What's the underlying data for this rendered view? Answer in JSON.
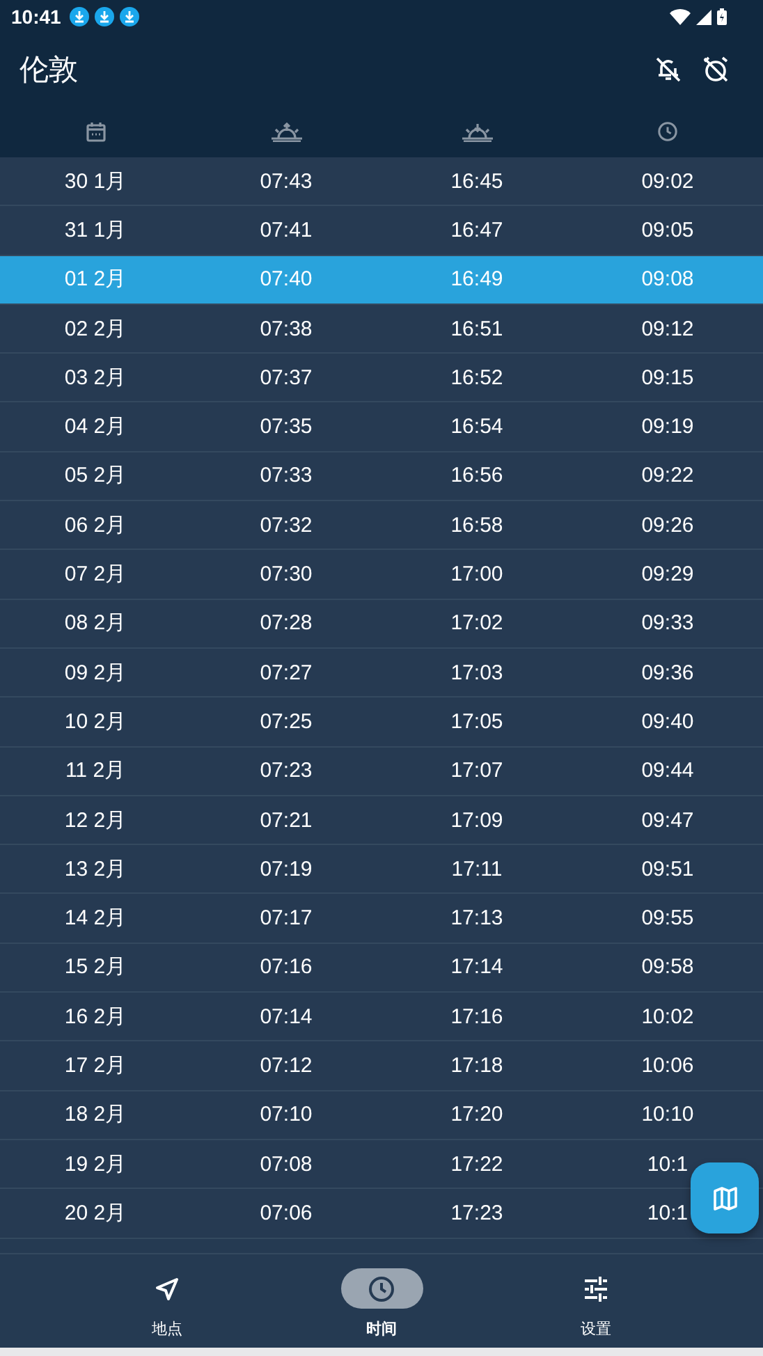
{
  "status_bar": {
    "time": "10:41"
  },
  "toolbar": {
    "title": "伦敦"
  },
  "rows": [
    {
      "date": "30 1月",
      "sunrise": "07:43",
      "sunset": "16:45",
      "day_length": "09:02",
      "selected": false
    },
    {
      "date": "31 1月",
      "sunrise": "07:41",
      "sunset": "16:47",
      "day_length": "09:05",
      "selected": false
    },
    {
      "date": "01 2月",
      "sunrise": "07:40",
      "sunset": "16:49",
      "day_length": "09:08",
      "selected": true
    },
    {
      "date": "02 2月",
      "sunrise": "07:38",
      "sunset": "16:51",
      "day_length": "09:12",
      "selected": false
    },
    {
      "date": "03 2月",
      "sunrise": "07:37",
      "sunset": "16:52",
      "day_length": "09:15",
      "selected": false
    },
    {
      "date": "04 2月",
      "sunrise": "07:35",
      "sunset": "16:54",
      "day_length": "09:19",
      "selected": false
    },
    {
      "date": "05 2月",
      "sunrise": "07:33",
      "sunset": "16:56",
      "day_length": "09:22",
      "selected": false
    },
    {
      "date": "06 2月",
      "sunrise": "07:32",
      "sunset": "16:58",
      "day_length": "09:26",
      "selected": false
    },
    {
      "date": "07 2月",
      "sunrise": "07:30",
      "sunset": "17:00",
      "day_length": "09:29",
      "selected": false
    },
    {
      "date": "08 2月",
      "sunrise": "07:28",
      "sunset": "17:02",
      "day_length": "09:33",
      "selected": false
    },
    {
      "date": "09 2月",
      "sunrise": "07:27",
      "sunset": "17:03",
      "day_length": "09:36",
      "selected": false
    },
    {
      "date": "10 2月",
      "sunrise": "07:25",
      "sunset": "17:05",
      "day_length": "09:40",
      "selected": false
    },
    {
      "date": "11 2月",
      "sunrise": "07:23",
      "sunset": "17:07",
      "day_length": "09:44",
      "selected": false
    },
    {
      "date": "12 2月",
      "sunrise": "07:21",
      "sunset": "17:09",
      "day_length": "09:47",
      "selected": false
    },
    {
      "date": "13 2月",
      "sunrise": "07:19",
      "sunset": "17:11",
      "day_length": "09:51",
      "selected": false
    },
    {
      "date": "14 2月",
      "sunrise": "07:17",
      "sunset": "17:13",
      "day_length": "09:55",
      "selected": false
    },
    {
      "date": "15 2月",
      "sunrise": "07:16",
      "sunset": "17:14",
      "day_length": "09:58",
      "selected": false
    },
    {
      "date": "16 2月",
      "sunrise": "07:14",
      "sunset": "17:16",
      "day_length": "10:02",
      "selected": false
    },
    {
      "date": "17 2月",
      "sunrise": "07:12",
      "sunset": "17:18",
      "day_length": "10:06",
      "selected": false
    },
    {
      "date": "18 2月",
      "sunrise": "07:10",
      "sunset": "17:20",
      "day_length": "10:10",
      "selected": false
    },
    {
      "date": "19 2月",
      "sunrise": "07:08",
      "sunset": "17:22",
      "day_length": "10:1",
      "selected": false
    },
    {
      "date": "20 2月",
      "sunrise": "07:06",
      "sunset": "17:23",
      "day_length": "10:1",
      "selected": false
    }
  ],
  "bottom_nav": [
    {
      "label": "地点",
      "selected": false
    },
    {
      "label": "时间",
      "selected": true
    },
    {
      "label": "设置",
      "selected": false
    }
  ]
}
